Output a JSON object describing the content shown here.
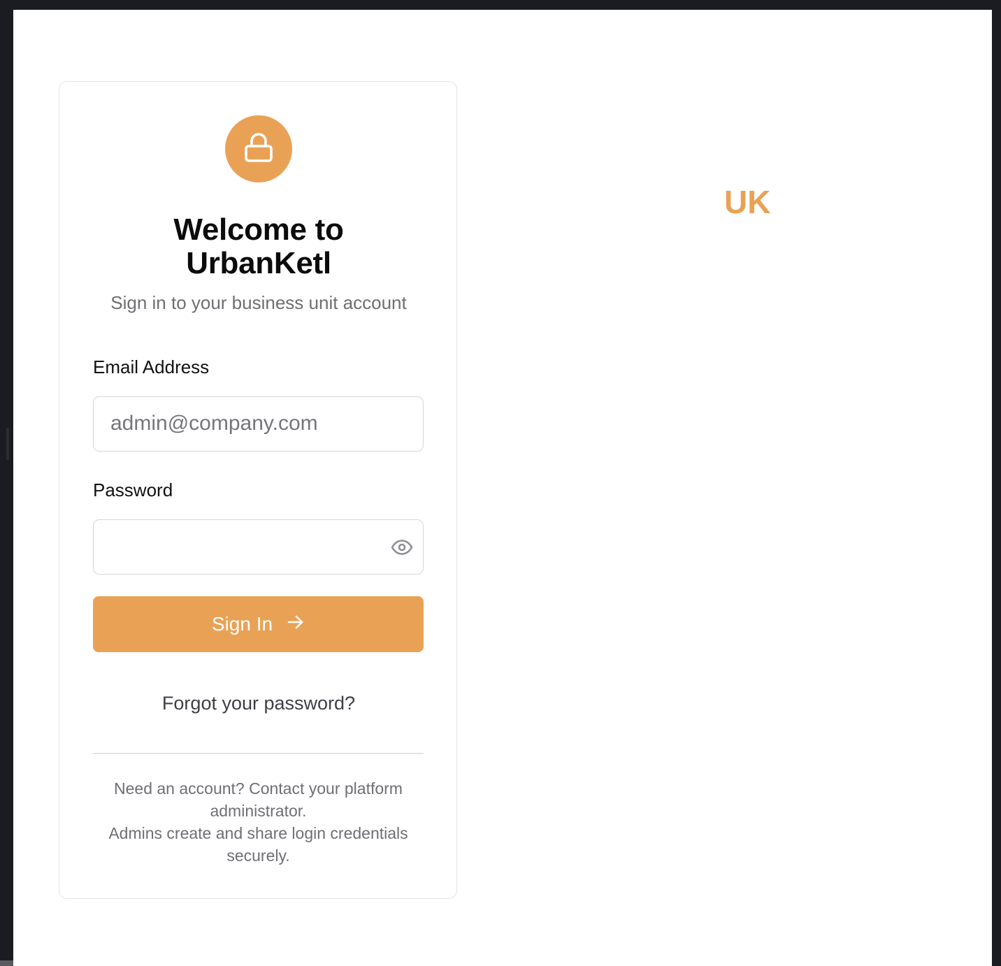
{
  "card": {
    "title_line1": "Welcome to",
    "title_line2": "UrbanKetl",
    "subtitle": "Sign in to your business unit account",
    "lock_icon": "lock-icon"
  },
  "form": {
    "email_label": "Email Address",
    "email_value": "",
    "email_placeholder": "admin@company.com",
    "password_label": "Password",
    "password_value": "",
    "password_placeholder": "",
    "password_toggle_icon": "eye-icon",
    "signin_label": "Sign In",
    "signin_icon": "arrow-right-icon",
    "forgot_label": "Forgot your password?"
  },
  "footer": {
    "line1": "Need an account? Contact your platform administrator.",
    "line2": "Admins create and share login credentials securely."
  },
  "brand": {
    "text": "UK"
  },
  "colors": {
    "accent": "#e9a255",
    "background": "#ffffff",
    "window_frame": "#1b1c21"
  }
}
